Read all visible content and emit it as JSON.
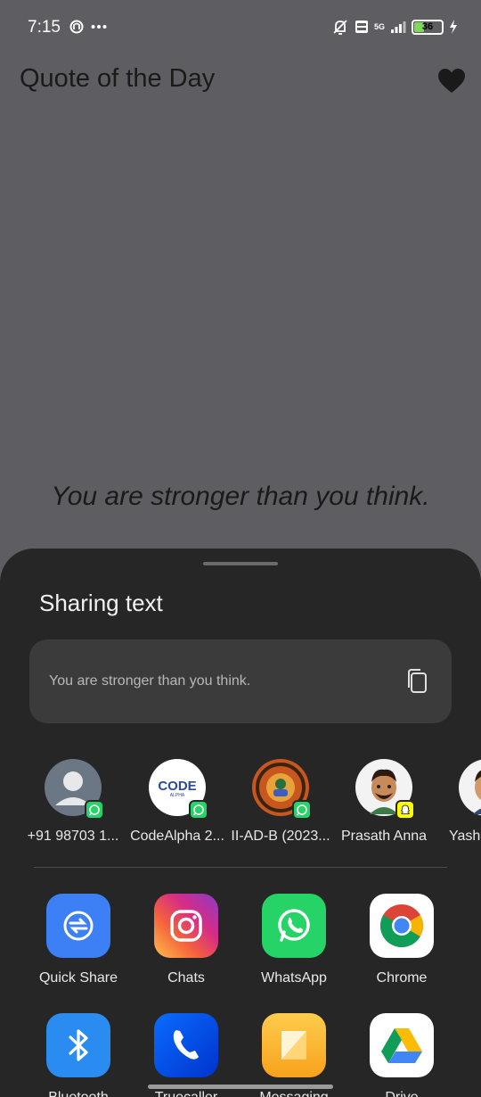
{
  "status_bar": {
    "time": "7:15",
    "network": "5G",
    "battery": "36",
    "battery_level": 0.36
  },
  "app": {
    "title": "Quote of the Day",
    "quote": "You are stronger than you think."
  },
  "share_sheet": {
    "title": "Sharing text",
    "preview_text": "You are stronger than you think.",
    "contacts": [
      {
        "label": "+91 98703 1...",
        "badge": "whatsapp"
      },
      {
        "label": "CodeAlpha 2...",
        "badge": "whatsapp",
        "avatar_text": "CODE",
        "avatar_subtext": "ALPHA"
      },
      {
        "label": "II-AD-B (2023...",
        "badge": "whatsapp"
      },
      {
        "label": "Prasath Anna",
        "badge": "snapchat"
      },
      {
        "label": "Yash",
        "badge": "none"
      }
    ],
    "apps": [
      {
        "label": "Quick Share"
      },
      {
        "label": "Chats"
      },
      {
        "label": "WhatsApp"
      },
      {
        "label": "Chrome"
      },
      {
        "label": "Bluetooth"
      },
      {
        "label": "Truecaller"
      },
      {
        "label": "Messaging"
      },
      {
        "label": "Drive"
      }
    ]
  },
  "colors": {
    "scrim": "#5e5d62",
    "sheet": "#262626",
    "whatsapp": "#25d366",
    "snapchat": "#fffc00"
  }
}
